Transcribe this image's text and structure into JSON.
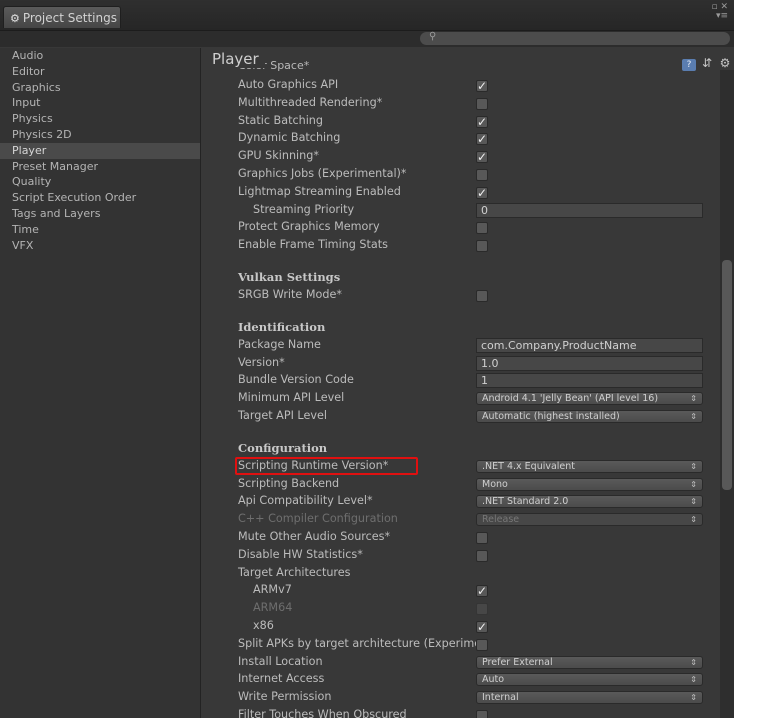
{
  "window": {
    "tab_title": "Project Settings"
  },
  "sidebar": {
    "items": [
      "Audio",
      "Editor",
      "Graphics",
      "Input",
      "Physics",
      "Physics 2D",
      "Player",
      "Preset Manager",
      "Quality",
      "Script Execution Order",
      "Tags and Layers",
      "Time",
      "VFX"
    ],
    "selected": "Player"
  },
  "main": {
    "title": "Player",
    "cutoff_label": "Color Space*"
  },
  "rows": [
    {
      "label": "Auto Graphics API",
      "type": "checkbox",
      "checked": true
    },
    {
      "label": "Multithreaded Rendering*",
      "type": "checkbox",
      "checked": false
    },
    {
      "label": "Static Batching",
      "type": "checkbox",
      "checked": true
    },
    {
      "label": "Dynamic Batching",
      "type": "checkbox",
      "checked": true
    },
    {
      "label": "GPU Skinning*",
      "type": "checkbox",
      "checked": true
    },
    {
      "label": "Graphics Jobs (Experimental)*",
      "type": "checkbox",
      "checked": false
    },
    {
      "label": "Lightmap Streaming Enabled",
      "type": "checkbox",
      "checked": true
    },
    {
      "label": "Streaming Priority",
      "type": "field",
      "value": "0",
      "indent": true
    },
    {
      "label": "Protect Graphics Memory",
      "type": "checkbox",
      "checked": false
    },
    {
      "label": "Enable Frame Timing Stats",
      "type": "checkbox",
      "checked": false
    },
    {
      "type": "spacer"
    },
    {
      "label": "Vulkan Settings",
      "type": "header"
    },
    {
      "label": "SRGB Write Mode*",
      "type": "checkbox",
      "checked": false
    },
    {
      "type": "spacer"
    },
    {
      "label": "Identification",
      "type": "header"
    },
    {
      "label": "Package Name",
      "type": "field",
      "value": "com.Company.ProductName"
    },
    {
      "label": "Version*",
      "type": "field",
      "value": "1.0"
    },
    {
      "label": "Bundle Version Code",
      "type": "field",
      "value": "1"
    },
    {
      "label": "Minimum API Level",
      "type": "dropdown",
      "value": "Android 4.1 'Jelly Bean' (API level 16)"
    },
    {
      "label": "Target API Level",
      "type": "dropdown",
      "value": "Automatic (highest installed)"
    },
    {
      "type": "spacer"
    },
    {
      "label": "Configuration",
      "type": "header"
    },
    {
      "label": "Scripting Runtime Version*",
      "type": "dropdown",
      "value": ".NET 4.x Equivalent",
      "highlight": true
    },
    {
      "label": "Scripting Backend",
      "type": "dropdown",
      "value": "Mono"
    },
    {
      "label": "Api Compatibility Level*",
      "type": "dropdown",
      "value": ".NET Standard 2.0"
    },
    {
      "label": "C++ Compiler Configuration",
      "type": "dropdown",
      "value": "Release",
      "disabled": true
    },
    {
      "label": "Mute Other Audio Sources*",
      "type": "checkbox",
      "checked": false
    },
    {
      "label": "Disable HW Statistics*",
      "type": "checkbox",
      "checked": false
    },
    {
      "label": "Target Architectures",
      "type": "label"
    },
    {
      "label": "ARMv7",
      "type": "checkbox",
      "checked": true,
      "indent": true
    },
    {
      "label": "ARM64",
      "type": "checkbox",
      "checked": false,
      "indent": true,
      "disabled": true
    },
    {
      "label": "x86",
      "type": "checkbox",
      "checked": true,
      "indent": true
    },
    {
      "label": "Split APKs by target architecture (Experimental)",
      "type": "checkbox",
      "checked": false,
      "clip": true
    },
    {
      "label": "Install Location",
      "type": "dropdown",
      "value": "Prefer External"
    },
    {
      "label": "Internet Access",
      "type": "dropdown",
      "value": "Auto"
    },
    {
      "label": "Write Permission",
      "type": "dropdown",
      "value": "Internal"
    },
    {
      "label": "Filter Touches When Obscured",
      "type": "checkbox",
      "checked": false
    }
  ],
  "icons": {
    "settings_tab": "gear-icon",
    "search": "search-icon",
    "help": "book-icon",
    "presets": "sliders-icon",
    "menu": "gear-menu-icon"
  },
  "colors": {
    "background": "#383838",
    "sidebar": "#333333",
    "highlight_border": "#e01010",
    "selection": "#4a4a4a"
  }
}
